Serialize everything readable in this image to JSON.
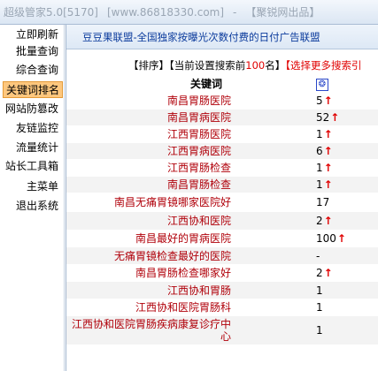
{
  "window": {
    "title": "超级管家5.0[5170]",
    "url": "[www.86818330.com]",
    "separator": "-",
    "brand": "【聚锐网出品】"
  },
  "sidebar": {
    "items": [
      {
        "label": "立即刷新",
        "active": false
      },
      {
        "label": "批量查询",
        "active": false
      },
      {
        "label": "综合查询",
        "active": false
      },
      {
        "label": "关键词排名",
        "active": true
      },
      {
        "label": "网站防篡改",
        "active": false
      },
      {
        "label": "友链监控",
        "active": false
      },
      {
        "label": "流量统计",
        "active": false
      },
      {
        "label": "站长工具箱",
        "active": false
      },
      {
        "label": "主菜单",
        "active": false
      },
      {
        "label": "退出系统",
        "active": false
      }
    ]
  },
  "banner": {
    "text": "豆豆果联盟-全国独家按曝光次数付费的日付广告联盟"
  },
  "toolbar": {
    "sort_label": "【排序】",
    "current_prefix": "【当前设置搜索前",
    "current_num": "100",
    "current_suffix": "名】",
    "more_label": "【选择更多搜索引"
  },
  "table": {
    "header_keyword": "关键词",
    "header_engine_icon": "baidu-paw-icon",
    "rows": [
      {
        "keyword": "南昌胃肠医院",
        "rank": "5",
        "up": true
      },
      {
        "keyword": "南昌胃病医院",
        "rank": "52",
        "up": true
      },
      {
        "keyword": "江西胃肠医院",
        "rank": "1",
        "up": true
      },
      {
        "keyword": "江西胃病医院",
        "rank": "6",
        "up": true
      },
      {
        "keyword": "江西胃肠检查",
        "rank": "1",
        "up": true
      },
      {
        "keyword": "南昌胃肠检查",
        "rank": "1",
        "up": true
      },
      {
        "keyword": "南昌无痛胃镜哪家医院好",
        "rank": "17",
        "up": false
      },
      {
        "keyword": "江西协和医院",
        "rank": "2",
        "up": true
      },
      {
        "keyword": "南昌最好的胃病医院",
        "rank": "100",
        "up": true
      },
      {
        "keyword": "无痛胃镜检查最好的医院",
        "rank": "-",
        "up": false
      },
      {
        "keyword": "南昌胃肠检查哪家好",
        "rank": "2",
        "up": true
      },
      {
        "keyword": "江西协和胃肠",
        "rank": "1",
        "up": false
      },
      {
        "keyword": "江西协和医院胃肠科",
        "rank": "1",
        "up": false
      },
      {
        "keyword": "江西协和医院胃肠疾病康复诊疗中心",
        "rank": "1",
        "up": false
      }
    ]
  },
  "colors": {
    "keyword_text": "#b0000a",
    "arrow": "#e00000",
    "active_nav_bg": "#fdc77e",
    "banner_link": "#0a3a9c"
  }
}
